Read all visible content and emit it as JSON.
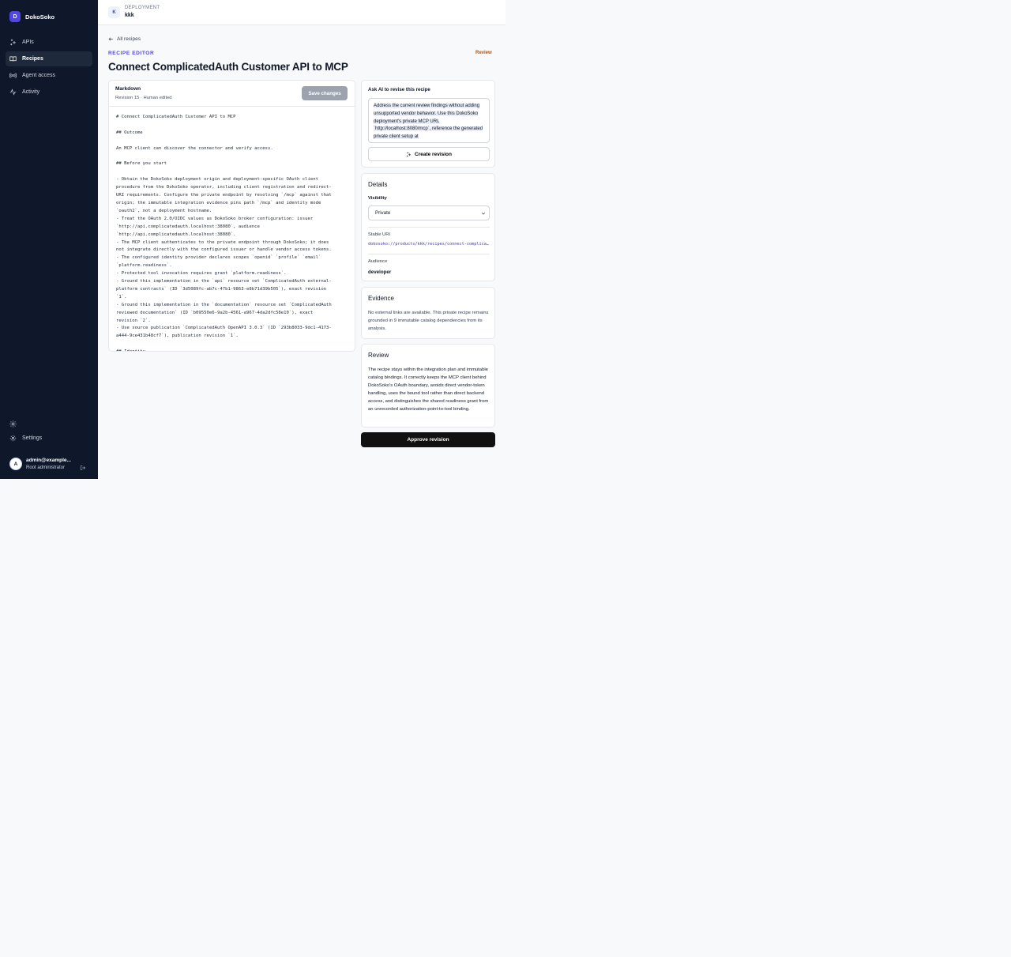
{
  "brand": {
    "logo_letter": "D",
    "name": "DokoSoko"
  },
  "sidebar": {
    "items": [
      {
        "label": "APIs",
        "icon": "sparkles-icon"
      },
      {
        "label": "Recipes",
        "icon": "book-open-icon",
        "active": true
      },
      {
        "label": "Agent access",
        "icon": "radio-icon"
      },
      {
        "label": "Activity",
        "icon": "activity-icon"
      }
    ],
    "theme_icon": "sun-icon",
    "settings_label": "Settings",
    "user": {
      "avatar": "A",
      "email": "admin@example...",
      "role": "Root administrator"
    }
  },
  "topbar": {
    "badge": "K",
    "label": "DEPLOYMENT",
    "name": "kkk"
  },
  "main": {
    "back_label": "All recipes",
    "eyebrow": "RECIPE EDITOR",
    "status": "Review",
    "title": "Connect ComplicatedAuth Customer API to MCP"
  },
  "editor": {
    "mode": "Markdown",
    "revision": "Revision 15 · Human edited",
    "save_label": "Save changes",
    "content": "# Connect ComplicatedAuth Customer API to MCP\n\n## Outcome\n\nAn MCP client can discover the connector and verify access.\n\n## Before you start\n\n- Obtain the DokoSoko deployment origin and deployment-specific OAuth client\nprocedure from the DokoSoko operator, including client registration and redirect-\nURI requirements. Configure the private endpoint by resolving `/mcp` against that\norigin; the immutable integration evidence pins path `/mcp` and identity mode\n`oauth2`, not a deployment hostname.\n- Treat the OAuth 2.0/OIDC values as DokoSoko broker configuration: issuer\n`http://api.complicatedauth.localhost:38080`, audience\n`http://api.complicatedauth.localhost:38080`.\n- The MCP client authenticates to the private endpoint through DokoSoko; it does\nnot integrate directly with the configured issuer or handle vendor access tokens.\n- The configured identity provider declares scopes `openid` `profile` `email`\n`platform.readiness`.\n- Protected tool invocation requires grant `platform.readiness`.\n- Ground this implementation in the `api` resource set `ComplicatedAuth external-\nplatform contracts` (ID `3d5089fc-ab7c-47b1-9863-e8b71d39b505`), exact revision\n`1`.\n- Ground this implementation in the `documentation` resource set `ComplicatedAuth\nreviewed documentation` (ID `b09550e6-9a2b-4561-a967-4da2dfc58e10`), exact\nrevision `2`.\n- Use source publication `ComplicatedAuth OpenAPI 3.0.3` (ID `293b8033-9dc1-4173-\na444-9ce431b48cf7`), publication revision `1`.\n\n## Identity"
  },
  "ask": {
    "label": "Ask AI to revise this recipe",
    "text": "Address the current review findings without adding unsupported vendor behavior. Use this DokoSoko deployment's private MCP URL `http://localhost:8080/mcp`, reference the generated private client setup at",
    "button_label": "Create revision",
    "button_icon": "sparkles-icon"
  },
  "details": {
    "title": "Details",
    "visibility_label": "Visibility",
    "visibility_value": "Private",
    "stable_uri_label": "Stable URI",
    "stable_uri": "dokosoko://products/kkk/recipes/connect-complicatedauth-customer-api-to-mcp",
    "audience_label": "Audience",
    "audience_value": "developer"
  },
  "evidence": {
    "title": "Evidence",
    "text": "No external links are available. This private recipe remains grounded in 9 immutable catalog dependencies from its analysis."
  },
  "review": {
    "title": "Review",
    "text": "The recipe stays within the integration plan and immutable catalog bindings. It correctly keeps the MCP client behind DokoSoko's OAuth boundary, avoids direct vendor-token handling, uses the bound tool rather than direct backend access, and distinguishes the shared readiness grant from an unrecorded authorization-point-to-tool binding."
  },
  "approve_label": "Approve revision",
  "colors": {
    "sidebar": "#0f172a",
    "accent": "#4f46e5",
    "review_status": "#b45309",
    "approve": "#111111"
  }
}
